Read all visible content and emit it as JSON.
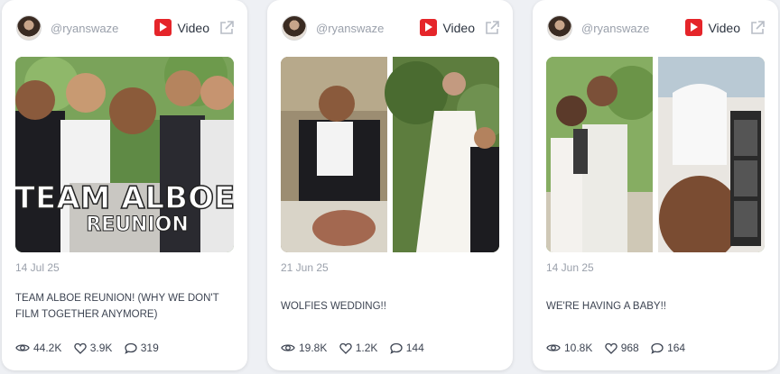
{
  "cards": [
    {
      "handle": "@ryanswaze",
      "platform_label": "Video",
      "thumbnail_text": [
        "TEAM ALBOE",
        "REUNION"
      ],
      "date": "14 Jul 25",
      "title": "TEAM ALBOE REUNION! (WHY WE DON'T FILM TOGETHER ANYMORE)",
      "views": "44.2K",
      "likes": "3.9K",
      "comments": "319"
    },
    {
      "handle": "@ryanswaze",
      "platform_label": "Video",
      "date": "21 Jun 25",
      "title": "WOLFIES WEDDING!!",
      "views": "19.8K",
      "likes": "1.2K",
      "comments": "144"
    },
    {
      "handle": "@ryanswaze",
      "platform_label": "Video",
      "date": "14 Jun 25",
      "title": "WE'RE HAVING A BABY!!",
      "views": "10.8K",
      "likes": "968",
      "comments": "164"
    }
  ],
  "icons": {
    "platform": "youtube-icon",
    "external": "external-link-icon",
    "views": "eye-icon",
    "likes": "heart-icon",
    "comments": "comment-icon"
  },
  "colors": {
    "youtube_red": "#e5252a",
    "muted_text": "#9aa0ab",
    "body_text": "#3d4452"
  }
}
